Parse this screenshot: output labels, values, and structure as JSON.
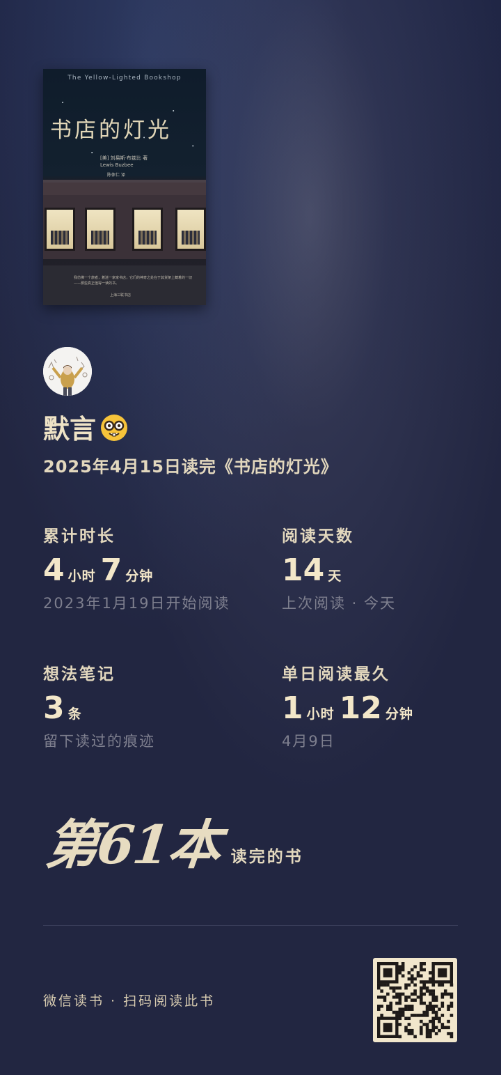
{
  "book": {
    "cover_title_en": "The Yellow-Lighted Bookshop",
    "cover_title_zh": "书店的灯光",
    "cover_author": "[美] 刘易斯·布兹比 著",
    "cover_author_en": "Lewis Buzbee",
    "cover_translator": "陈体仁 译",
    "cover_quote": "我仿佛一个旅者，着迷一家家书店，它们的神奇之处在于其货架上藏着的一切——那些真正值得一读的书。",
    "cover_publisher": "上海三联书店"
  },
  "user": {
    "name": "默言",
    "emoji": "nerd-face-icon"
  },
  "finish_line": "2025年4月15日读完《书店的灯光》",
  "stats": {
    "total_time": {
      "label": "累计时长",
      "hours": "4",
      "hours_unit": "小时",
      "minutes": "7",
      "minutes_unit": "分钟",
      "sub": "2023年1月19日开始阅读"
    },
    "reading_days": {
      "label": "阅读天数",
      "value": "14",
      "unit": "天",
      "sub": "上次阅读 · 今天"
    },
    "notes": {
      "label": "想法笔记",
      "value": "3",
      "unit": "条",
      "sub": "留下读过的痕迹"
    },
    "longest_day": {
      "label": "单日阅读最久",
      "hours": "1",
      "hours_unit": "小时",
      "minutes": "12",
      "minutes_unit": "分钟",
      "sub": "4月9日"
    }
  },
  "nth_book": {
    "big": "第61本",
    "small": "读完的书"
  },
  "footer": {
    "text": "微信读书 · 扫码阅读此书"
  },
  "colors": {
    "background": "#222641",
    "accent": "#eadfc6",
    "muted": "#7e7f8e"
  }
}
